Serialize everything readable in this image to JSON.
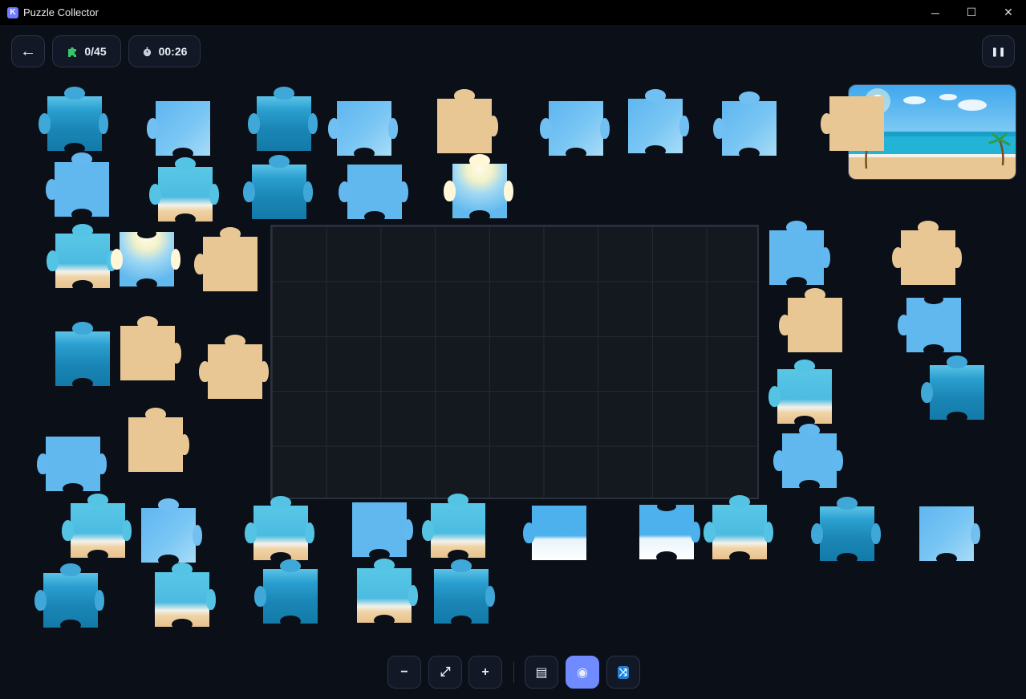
{
  "window": {
    "title": "Puzzle Collector",
    "app_icon": "K"
  },
  "window_controls": {
    "minimize": "─",
    "maximize": "☐",
    "close": "✕"
  },
  "hud": {
    "back": "←",
    "pieces_count": "0/45",
    "timer": "00:26",
    "pause": "❚❚"
  },
  "controls": {
    "zoom_out": "−",
    "fit": "⤢",
    "zoom_in": "+",
    "tray": "▤",
    "preview": "◉",
    "shuffle": "⤨"
  },
  "colors": {
    "background": "#0b0f18",
    "accent": "#6f8bff",
    "puzzle_piece_icon": "#37c26b"
  }
}
